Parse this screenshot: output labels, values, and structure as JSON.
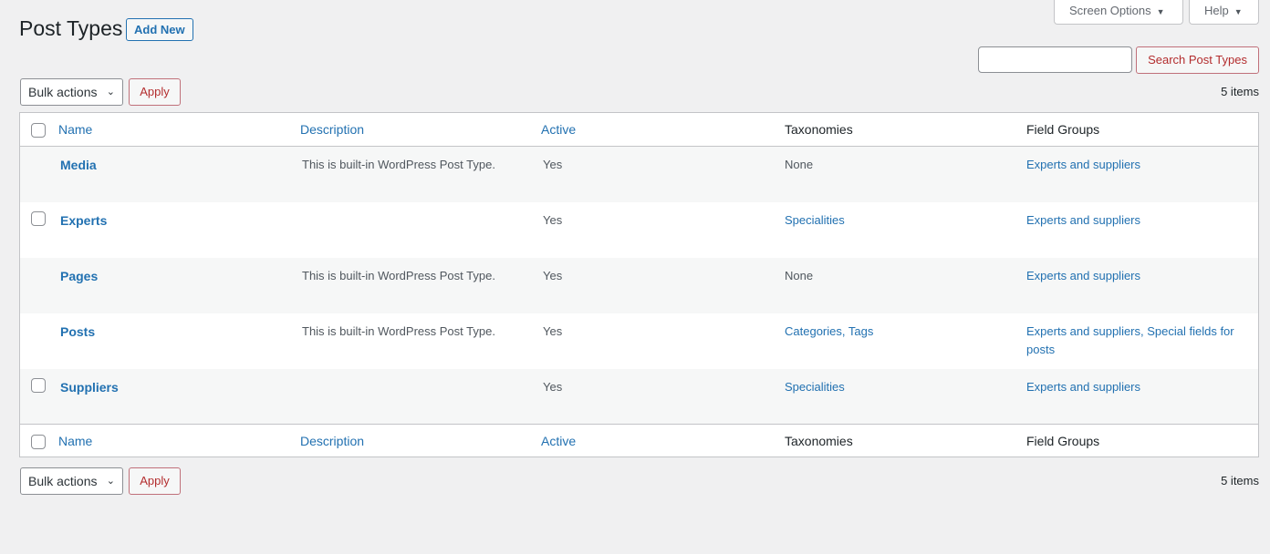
{
  "header": {
    "title": "Post Types",
    "add_new_label": "Add New",
    "screen_options_label": "Screen Options",
    "help_label": "Help"
  },
  "search": {
    "value": "",
    "placeholder": "",
    "button_label": "Search Post Types"
  },
  "bulk": {
    "select_label": "Bulk actions",
    "apply_label": "Apply",
    "item_count": "5 items"
  },
  "table": {
    "columns": {
      "name": "Name",
      "description": "Description",
      "active": "Active",
      "taxonomies": "Taxonomies",
      "field_groups": "Field Groups"
    },
    "rows": [
      {
        "name": "Media",
        "has_checkbox": false,
        "description": "This is built-in WordPress Post Type.",
        "active": "Yes",
        "taxonomies": "None",
        "taxonomies_linked": false,
        "field_groups": "Experts and suppliers"
      },
      {
        "name": "Experts",
        "has_checkbox": true,
        "description": "",
        "active": "Yes",
        "taxonomies": "Specialities",
        "taxonomies_linked": true,
        "field_groups": "Experts and suppliers"
      },
      {
        "name": "Pages",
        "has_checkbox": false,
        "description": "This is built-in WordPress Post Type.",
        "active": "Yes",
        "taxonomies": "None",
        "taxonomies_linked": false,
        "field_groups": "Experts and suppliers"
      },
      {
        "name": "Posts",
        "has_checkbox": false,
        "description": "This is built-in WordPress Post Type.",
        "active": "Yes",
        "taxonomies": "Categories, Tags",
        "taxonomies_linked": true,
        "field_groups": "Experts and suppliers, Special fields for posts"
      },
      {
        "name": "Suppliers",
        "has_checkbox": true,
        "description": "",
        "active": "Yes",
        "taxonomies": "Specialities",
        "taxonomies_linked": true,
        "field_groups": "Experts and suppliers"
      }
    ]
  },
  "colors": {
    "link": "#2271b1",
    "danger": "#b32d2e",
    "background": "#f0f0f1"
  }
}
